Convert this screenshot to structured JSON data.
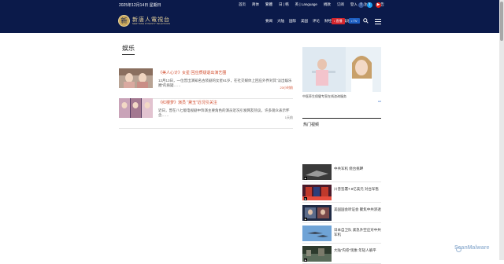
{
  "header": {
    "date": "2025年12月14日 星期日",
    "top_links": [
      "首页",
      "简体",
      "繁體",
      "日 | 韩",
      "英 | Language",
      "捐款",
      "订阅",
      "登入",
      "注册",
      "广告"
    ],
    "social_icons": [
      "facebook-icon",
      "twitter-icon",
      "youtube-icon"
    ],
    "logo_title": "新唐人電視台",
    "logo_subtitle": "NEW TANG DYNASTY TELEVISION",
    "nav_items": [
      "要闻",
      "大陆",
      "国际",
      "美国",
      "评论",
      "财经",
      "生活娱乐"
    ],
    "live_button": "• 直播",
    "tv_button": "• TV"
  },
  "main": {
    "section_title": "娱乐",
    "articles": [
      {
        "title": "《美人心计》女星 回应质疑退出演艺圈",
        "summary": "12月13日，一位曾出演知名古装剧的女星61岁，在社交媒体上回应外界对其“淡出娱乐圈”的质疑……",
        "meta": "23小时前"
      },
      {
        "title": "《红楼梦》演员 “黛玉”近况引关注",
        "summary": "近日，曾在八七版电视剧中饰演主要角色的演员近况引发网友热议，许多观众表示怀念……",
        "meta": "1天前"
      }
    ]
  },
  "sidebar": {
    "ad_caption": "中医养生保健专家在线咨询服务",
    "ad_mark": "Ad",
    "section_title": "热门视频",
    "videos": [
      {
        "title": "中共军机 绕台挑衅"
      },
      {
        "title": "川普签署7.8亿美元 对台军售"
      },
      {
        "title": "美国国会听证会 聚焦中共渗透"
      },
      {
        "title": "日本自卫队 紧急升空应对中共军机"
      },
      {
        "title": "大陆“内卷”现象 年轻人躺平"
      }
    ]
  },
  "watermark": "ScanMalware",
  "colors": {
    "header_bg": "#0b1a4a",
    "live_red": "#d4262d",
    "tv_blue": "#1e5fc2",
    "headline_orange": "#d14a2a"
  }
}
